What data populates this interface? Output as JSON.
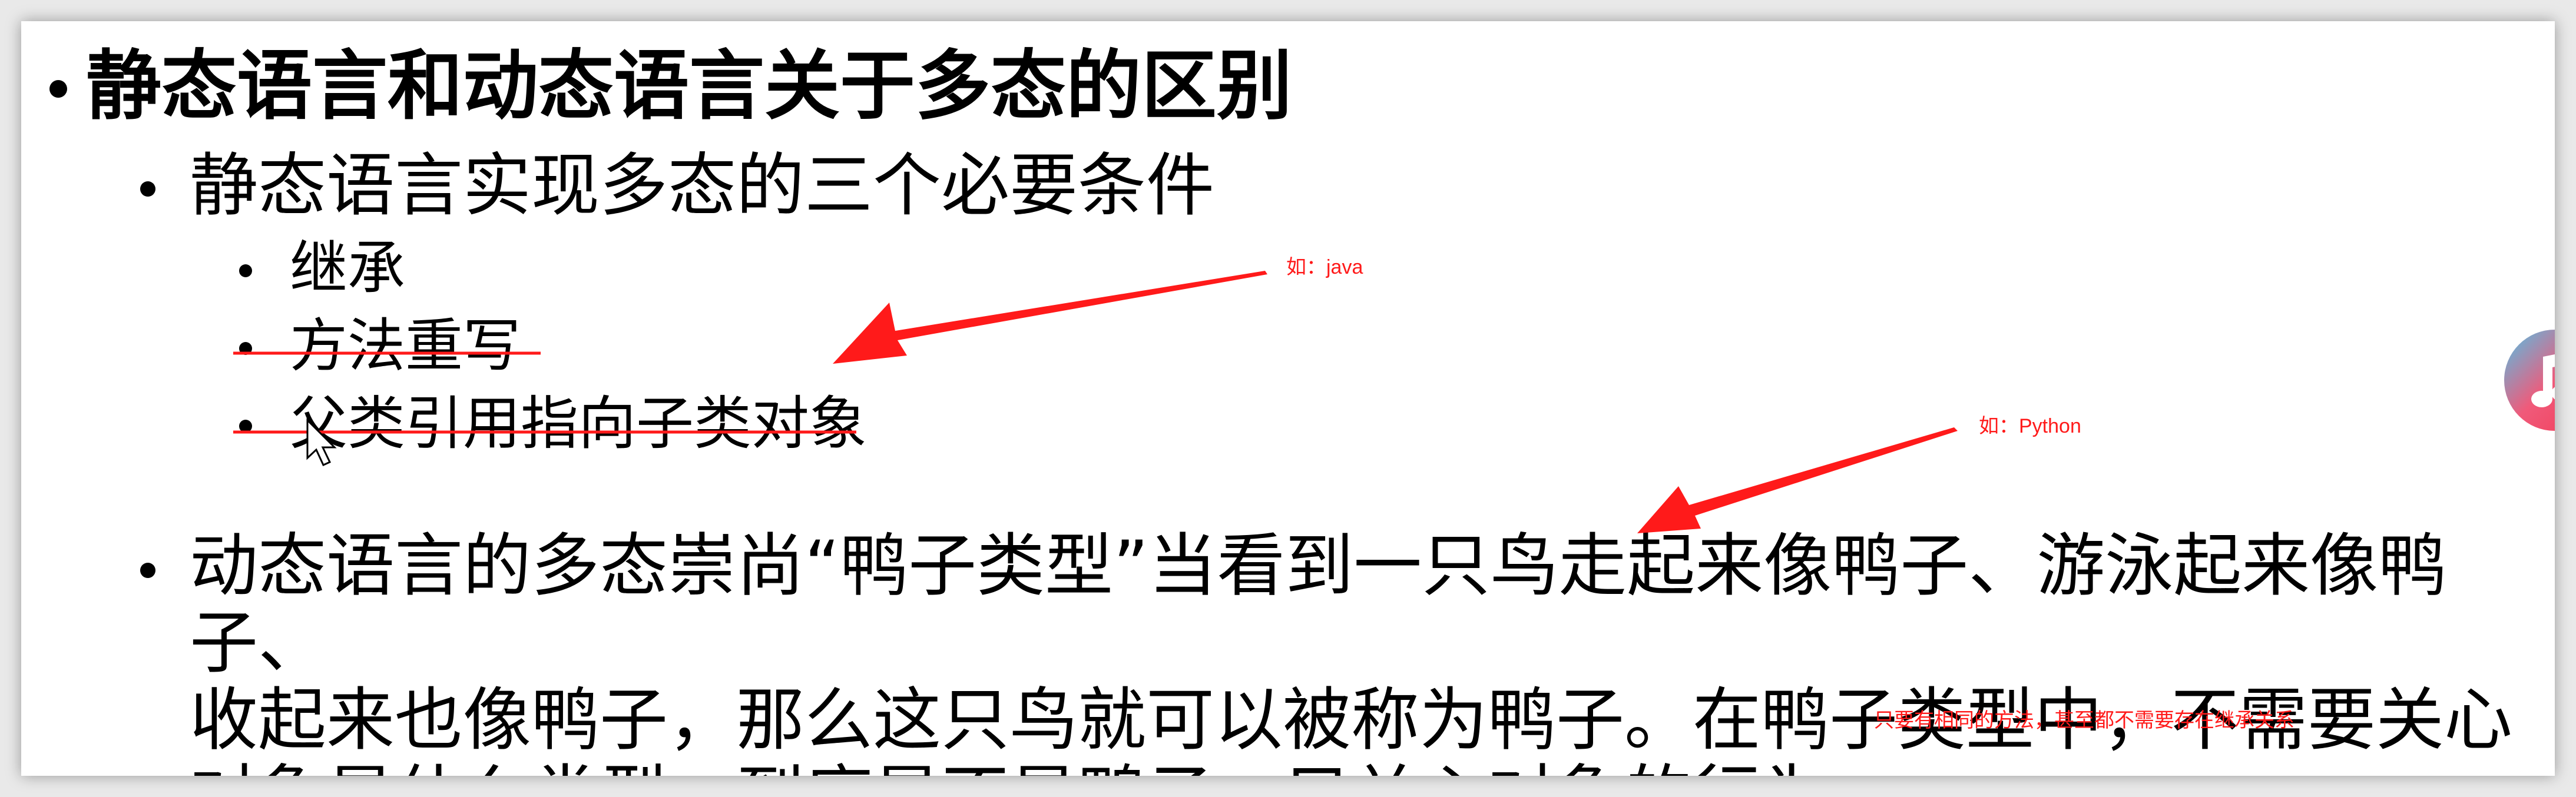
{
  "slide": {
    "title": "静态语言和动态语言关于多态的区别",
    "subtitle": "静态语言实现多态的三个必要条件",
    "conditions": [
      "继承",
      "方法重写",
      "父类引用指向子类对象"
    ],
    "dynamic_paragraph": "动态语言的多态崇尚“鸭子类型”当看到一只鸟走起来像鸭子、游泳起来像鸭子、\n收起来也像鸭子，那么这只鸟就可以被称为鸭子。在鸭子类型中，不需要关心\n对象是什么类型，到底是不是鸭子，只关心对象的行为。"
  },
  "annotations": {
    "java_note": "如：java",
    "python_note": "如：Python",
    "inheritance_note": "只要有相同的方法，甚至都不需要存在继承关系"
  },
  "colors": {
    "annotation": "#ff1a1a",
    "text": "#000000",
    "background": "#ffffff"
  },
  "icons": {
    "cursor": "mouse-pointer-icon",
    "side": "music-app-icon"
  }
}
